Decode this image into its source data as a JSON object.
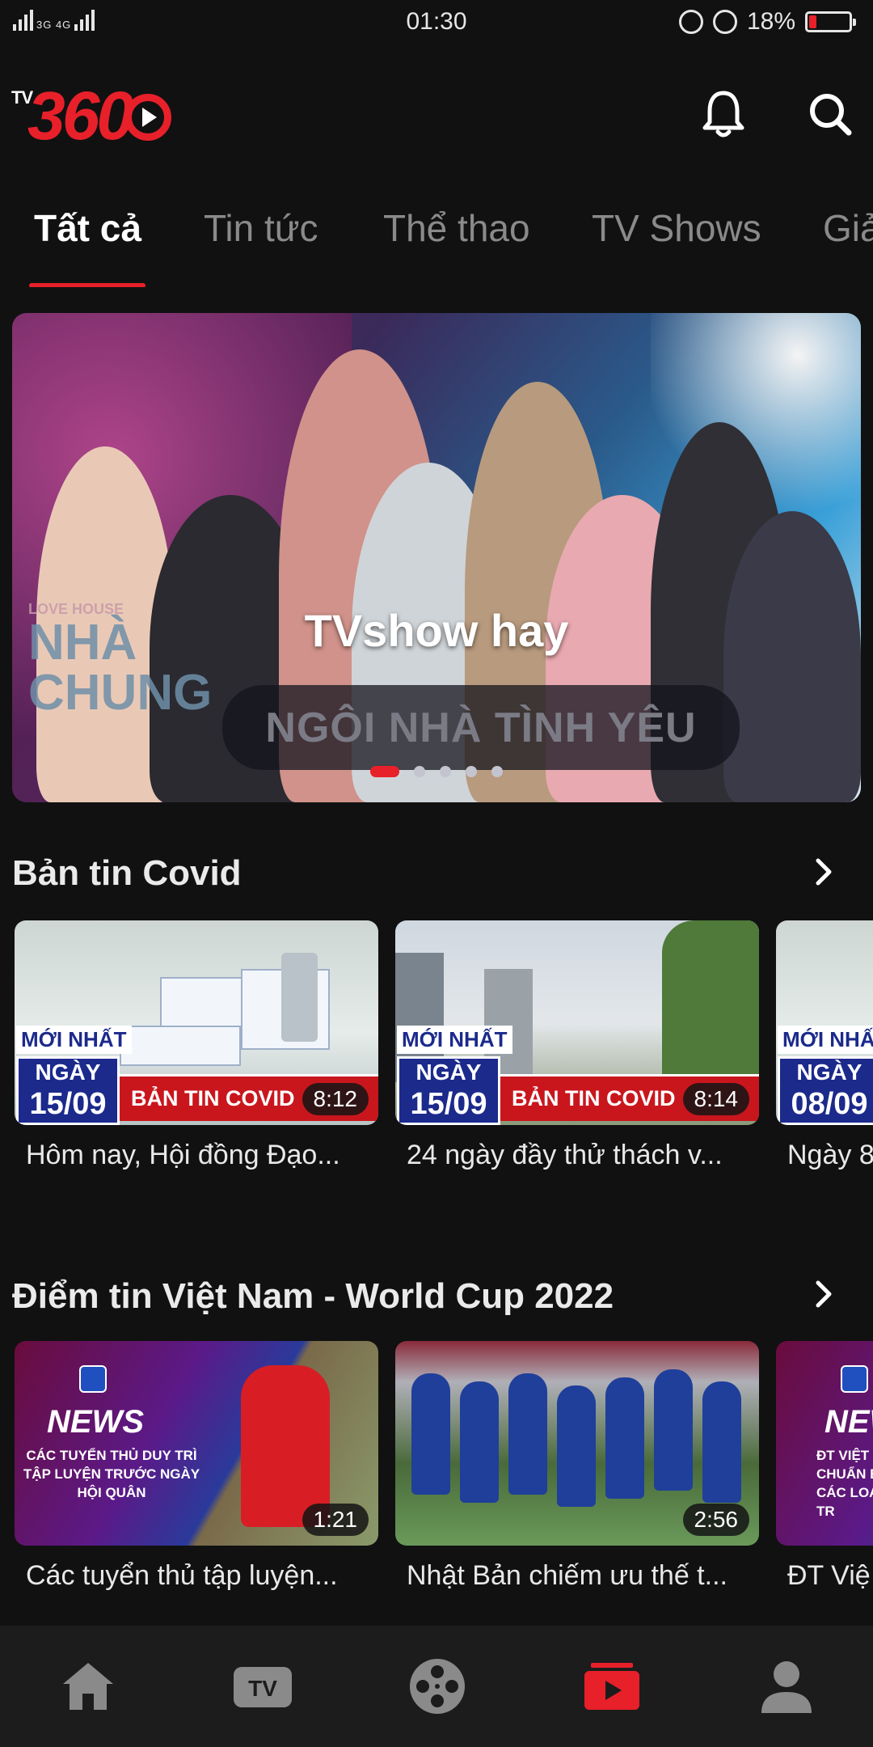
{
  "status_bar": {
    "network": "3G 4G",
    "time": "01:30",
    "battery_percent": "18%",
    "battery_level": 0.18,
    "battery_color": "#e8202a"
  },
  "header": {
    "logo_tv": "TV",
    "logo_num": "360",
    "bell_icon": "bell-icon",
    "search_icon": "search-icon"
  },
  "tabs": [
    {
      "label": "Tất cả",
      "active": true
    },
    {
      "label": "Tin tức",
      "active": false
    },
    {
      "label": "Thể thao",
      "active": false
    },
    {
      "label": "TV Shows",
      "active": false
    },
    {
      "label": "Giả",
      "active": false
    }
  ],
  "banner": {
    "title": "TVshow hay",
    "sign_text": "NGÔI NHÀ TÌNH YÊU",
    "house_text": "NHÀ CHUNG",
    "house_sub": "LOVE HOUSE",
    "slide_count": 5,
    "active_slide": 1
  },
  "sections": {
    "covid": {
      "title": "Bản tin Covid",
      "cards": [
        {
          "title": "Hôm nay, Hội đồng Đạo...",
          "duration": "8:12",
          "badge_new": "MỚI NHẤT",
          "day_label": "NGÀY",
          "date": "15/09",
          "banner": "BẢN TIN COVID"
        },
        {
          "title": "24 ngày đầy thử thách v...",
          "duration": "8:14",
          "badge_new": "MỚI NHẤT",
          "day_label": "NGÀY",
          "date": "15/09",
          "banner": "BẢN TIN COVID"
        },
        {
          "title": "Ngày 8",
          "duration": "",
          "badge_new": "MỚI NHẤT",
          "day_label": "NGÀY",
          "date": "08/09",
          "banner": ""
        }
      ]
    },
    "worldcup": {
      "title": "Điểm tin Việt Nam - World Cup 2022",
      "cards": [
        {
          "title": "Các tuyển thủ tập luyện...",
          "duration": "1:21",
          "label": "NEWS",
          "sub": "CÁC TUYỂN THỦ DUY TRÌ TẬP LUYỆN TRƯỚC NGÀY HỘI QUÂN"
        },
        {
          "title": "Nhật Bản chiếm ưu thế t...",
          "duration": "2:56",
          "label": "",
          "sub": ""
        },
        {
          "title": "ĐT Việ",
          "duration": "",
          "label": "NEW",
          "sub": "ĐT VIỆT N CHUẨN BỊ CÁC LOẠT TR"
        }
      ]
    }
  },
  "bottom_nav": [
    {
      "icon": "home-icon",
      "active": false
    },
    {
      "icon": "tv-icon",
      "active": false
    },
    {
      "icon": "film-reel-icon",
      "active": false
    },
    {
      "icon": "video-play-icon",
      "active": true
    },
    {
      "icon": "user-icon",
      "active": false
    }
  ],
  "colors": {
    "accent": "#e8202a",
    "background": "#111111",
    "nav_inactive": "#8a8a8a"
  }
}
